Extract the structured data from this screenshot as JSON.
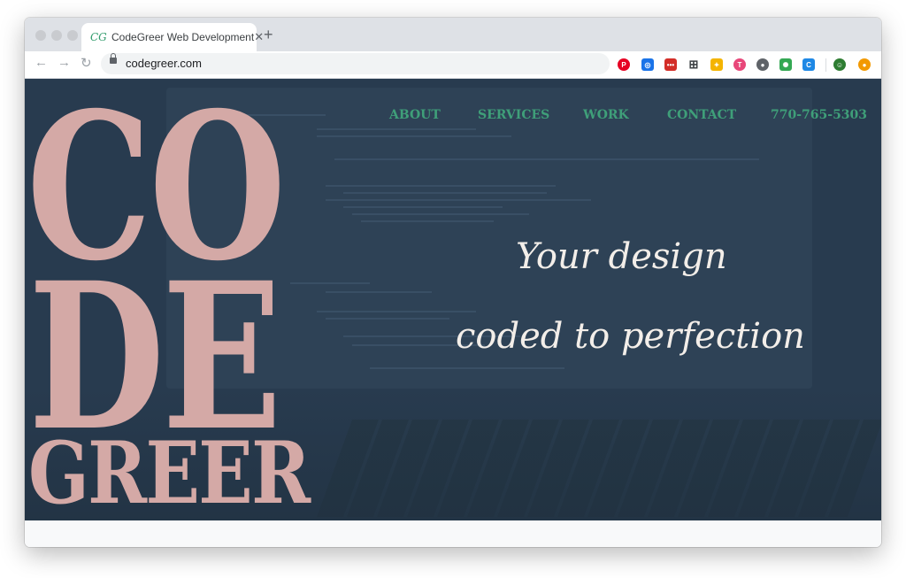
{
  "browser": {
    "tab_title": "CodeGreer Web Development",
    "tab_favicon_text": "CG",
    "url": "codegreer.com",
    "icons": {
      "back": "back-arrow-icon",
      "forward": "forward-arrow-icon",
      "reload": "reload-icon",
      "star": "star-icon",
      "new_tab": "plus-icon"
    },
    "extensions": [
      {
        "name": "pinterest-icon",
        "color": "#e60023",
        "glyph": "P"
      },
      {
        "name": "safari-compass-icon",
        "color": "#1a73e8",
        "glyph": "◎"
      },
      {
        "name": "lastpass-icon",
        "color": "#d32d27",
        "glyph": "•••"
      },
      {
        "name": "grid-icon",
        "color": "#ffffff",
        "glyph": "⊞"
      },
      {
        "name": "colorful-extension-icon",
        "color": "#f4b400",
        "glyph": "✦"
      },
      {
        "name": "t-extension-icon",
        "color": "#e8477a",
        "glyph": "T"
      },
      {
        "name": "circle-extension-icon",
        "color": "#5f6368",
        "glyph": "●"
      },
      {
        "name": "pinwheel-extension-icon",
        "color": "#34a853",
        "glyph": "✺"
      },
      {
        "name": "c-extension-icon",
        "color": "#1e88e5",
        "glyph": "C"
      },
      {
        "name": "profile-avatar-icon",
        "color": "#2e7d32",
        "glyph": "☺"
      },
      {
        "name": "orange-extension-icon",
        "color": "#f29900",
        "glyph": "●"
      }
    ]
  },
  "site": {
    "logo": {
      "line1": "CO",
      "line2": "DE",
      "line3": "GREER"
    },
    "nav": {
      "about": "ABOUT",
      "services": "SERVICES",
      "work": "WORK",
      "contact": "CONTACT",
      "phone": "770-765-5303"
    },
    "tagline": {
      "line1": "Your design",
      "line2": "coded to perfection"
    },
    "colors": {
      "hero_bg": "#283b4f",
      "logo": "#d4a9a6",
      "nav": "#3f9f79",
      "tagline": "#f3eee9"
    }
  }
}
